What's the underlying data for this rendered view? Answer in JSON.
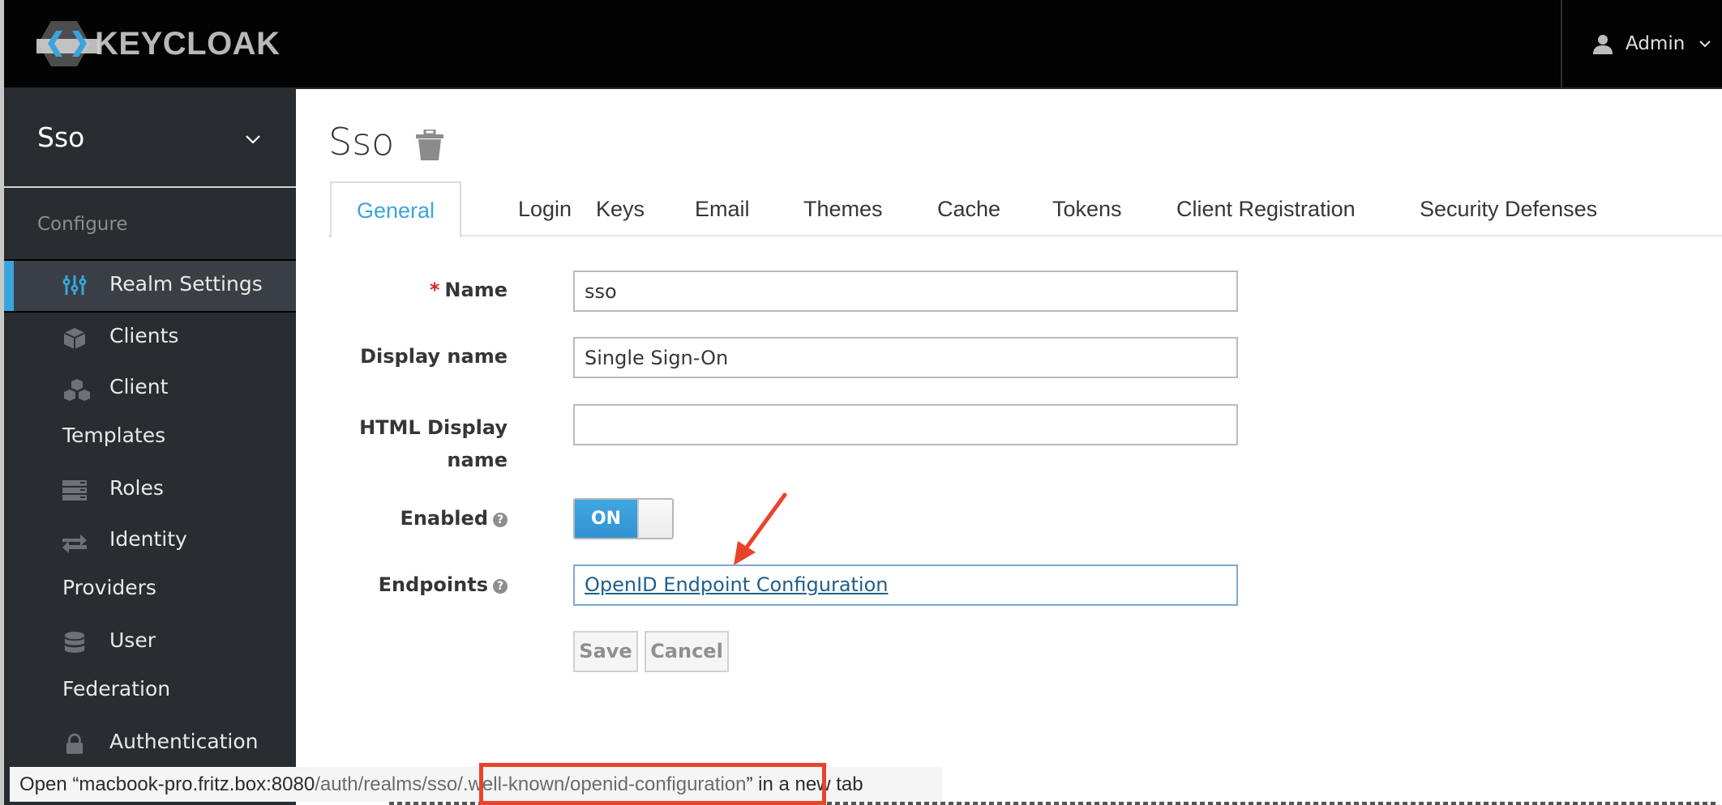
{
  "header": {
    "brand": "KEYCLOAK",
    "user_menu_label": "Admin",
    "colors": {
      "background": "#030303",
      "logo_accent": "#39a5dc"
    }
  },
  "sidebar": {
    "realm_name": "Sso",
    "section_heading": "Configure",
    "items": [
      {
        "label": "Realm Settings",
        "icon": "sliders-icon",
        "active": true
      },
      {
        "label": "Clients",
        "icon": "cube-icon"
      },
      {
        "label_line1": "Client",
        "label_line2": "Templates",
        "icon": "cubes-icon"
      },
      {
        "label": "Roles",
        "icon": "server-stack-icon"
      },
      {
        "label_line1": "Identity",
        "label_line2": "Providers",
        "icon": "exchange-arrows-icon"
      },
      {
        "label_line1": "User",
        "label_line2": "Federation",
        "icon": "database-icon"
      },
      {
        "label": "Authentication",
        "icon": "lock-icon"
      }
    ]
  },
  "main": {
    "title": "Sso",
    "tabs": [
      {
        "label": "General",
        "active": true
      },
      {
        "label": "Login"
      },
      {
        "label": "Keys"
      },
      {
        "label": "Email"
      },
      {
        "label": "Themes"
      },
      {
        "label": "Cache"
      },
      {
        "label": "Tokens"
      },
      {
        "label": "Client Registration"
      },
      {
        "label": "Security Defenses"
      }
    ],
    "form": {
      "name_label": "Name",
      "name_required_marker": "*",
      "name_value": "sso",
      "display_name_label": "Display name",
      "display_name_value": "Single Sign-On",
      "html_display_name_label_line1": "HTML Display",
      "html_display_name_label_line2": "name",
      "html_display_name_value": "",
      "enabled_label": "Enabled",
      "enabled_state": "ON",
      "endpoints_label": "Endpoints",
      "endpoint_link": "OpenID Endpoint Configuration",
      "help_glyph": "?",
      "save_label": "Save",
      "cancel_label": "Cancel"
    }
  },
  "status_bar": {
    "prefix": "Open “",
    "host": "macbook-pro.fritz.box:8080",
    "path": "/auth/realms/sso/.well-known/openid-configuration",
    "suffix_quote": "”",
    "suffix": " in a new tab"
  },
  "annotation": {
    "color": "#e8442a"
  }
}
